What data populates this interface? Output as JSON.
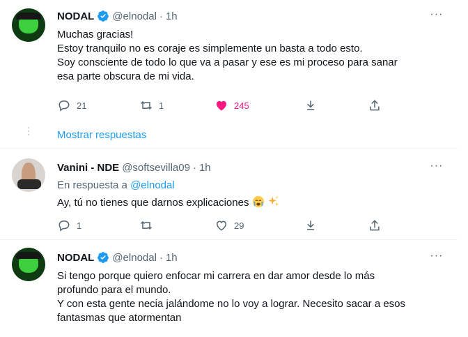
{
  "tweets": [
    {
      "name": "NODAL",
      "handle": "@elnodal",
      "dot": "·",
      "time": "1h",
      "lines": [
        "Muchas gracias!",
        "Estoy tranquilo no es coraje es simplemente un basta a todo esto.",
        "Soy consciente de todo lo que va a pasar y ese es mi proceso para sanar",
        "esa parte obscura de mi vida."
      ],
      "replies": "21",
      "retweets": "1",
      "likes": "245"
    },
    {
      "show_replies": "Mostrar respuestas"
    },
    {
      "name": "Vanini - NDE",
      "handle": "@softsevilla09",
      "dot": "·",
      "time": "1h",
      "reply_prefix": "En respuesta a",
      "reply_handle": "@elnodal",
      "text": "Ay, tú no tienes que darnos explicaciones",
      "replies": "1",
      "retweets": "",
      "likes": "29"
    },
    {
      "name": "NODAL",
      "handle": "@elnodal",
      "dot": "·",
      "time": "1h",
      "lines": [
        "Si tengo porque quiero enfocar mi carrera en dar amor desde lo más",
        "profundo para el mundo.",
        "Y con esta gente necia jalándome no lo voy a lograr. Necesito sacar a esos",
        "fantasmas que atormentan"
      ]
    }
  ],
  "more_icon": "···",
  "colors": {
    "accent": "#1d9bf0",
    "like": "#f91880",
    "muted": "#536471"
  }
}
